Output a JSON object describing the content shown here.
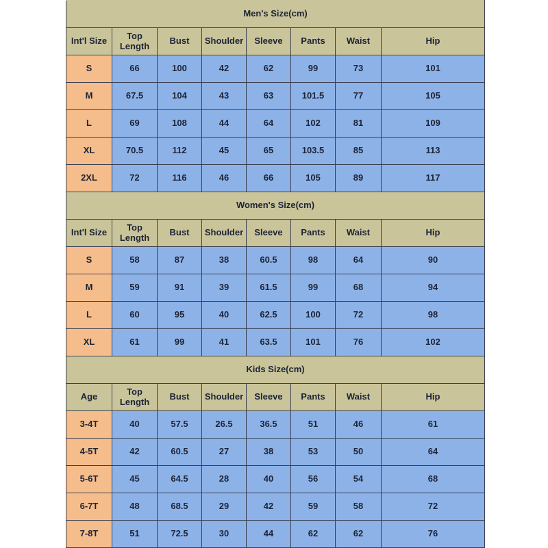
{
  "page": {
    "background_color": "#ffffff",
    "table_border_color": "#3a3f52",
    "colors": {
      "header_tan": "#c9c49a",
      "size_peach": "#f6bd8c",
      "data_blue": "#8db2e8"
    }
  },
  "sections": [
    {
      "title": "Men's Size(cm)",
      "columns": [
        "Int'l Size",
        "Top Length",
        "Bust",
        "Shoulder",
        "Sleeve",
        "Pants",
        "Waist",
        "Hip"
      ],
      "rows": [
        [
          "S",
          "66",
          "100",
          "42",
          "62",
          "99",
          "73",
          "101"
        ],
        [
          "M",
          "67.5",
          "104",
          "43",
          "63",
          "101.5",
          "77",
          "105"
        ],
        [
          "L",
          "69",
          "108",
          "44",
          "64",
          "102",
          "81",
          "109"
        ],
        [
          "XL",
          "70.5",
          "112",
          "45",
          "65",
          "103.5",
          "85",
          "113"
        ],
        [
          "2XL",
          "72",
          "116",
          "46",
          "66",
          "105",
          "89",
          "117"
        ]
      ]
    },
    {
      "title": "Women's Size(cm)",
      "columns": [
        "Int'l Size",
        "Top Length",
        "Bust",
        "Shoulder",
        "Sleeve",
        "Pants",
        "Waist",
        "Hip"
      ],
      "rows": [
        [
          "S",
          "58",
          "87",
          "38",
          "60.5",
          "98",
          "64",
          "90"
        ],
        [
          "M",
          "59",
          "91",
          "39",
          "61.5",
          "99",
          "68",
          "94"
        ],
        [
          "L",
          "60",
          "95",
          "40",
          "62.5",
          "100",
          "72",
          "98"
        ],
        [
          "XL",
          "61",
          "99",
          "41",
          "63.5",
          "101",
          "76",
          "102"
        ]
      ]
    },
    {
      "title": "Kids Size(cm)",
      "columns": [
        "Age",
        "Top Length",
        "Bust",
        "Shoulder",
        "Sleeve",
        "Pants",
        "Waist",
        "Hip"
      ],
      "rows": [
        [
          "3-4T",
          "40",
          "57.5",
          "26.5",
          "36.5",
          "51",
          "46",
          "61"
        ],
        [
          "4-5T",
          "42",
          "60.5",
          "27",
          "38",
          "53",
          "50",
          "64"
        ],
        [
          "5-6T",
          "45",
          "64.5",
          "28",
          "40",
          "56",
          "54",
          "68"
        ],
        [
          "6-7T",
          "48",
          "68.5",
          "29",
          "42",
          "59",
          "58",
          "72"
        ],
        [
          "7-8T",
          "51",
          "72.5",
          "30",
          "44",
          "62",
          "62",
          "76"
        ]
      ]
    }
  ]
}
